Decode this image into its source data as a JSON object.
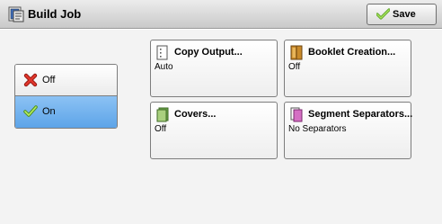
{
  "header": {
    "title": "Build Job",
    "save_label": "Save"
  },
  "toggle": {
    "off_label": "Off",
    "on_label": "On",
    "selected": "On"
  },
  "tiles": [
    {
      "title": "Copy Output...",
      "value": "Auto"
    },
    {
      "title": "Booklet Creation...",
      "value": "Off"
    },
    {
      "title": "Covers...",
      "value": "Off"
    },
    {
      "title": "Segment Separators...",
      "value": "No Separators"
    }
  ],
  "colors": {
    "selected": "#6aaeed",
    "check": "#8fd13a",
    "cross": "#d0261d"
  }
}
